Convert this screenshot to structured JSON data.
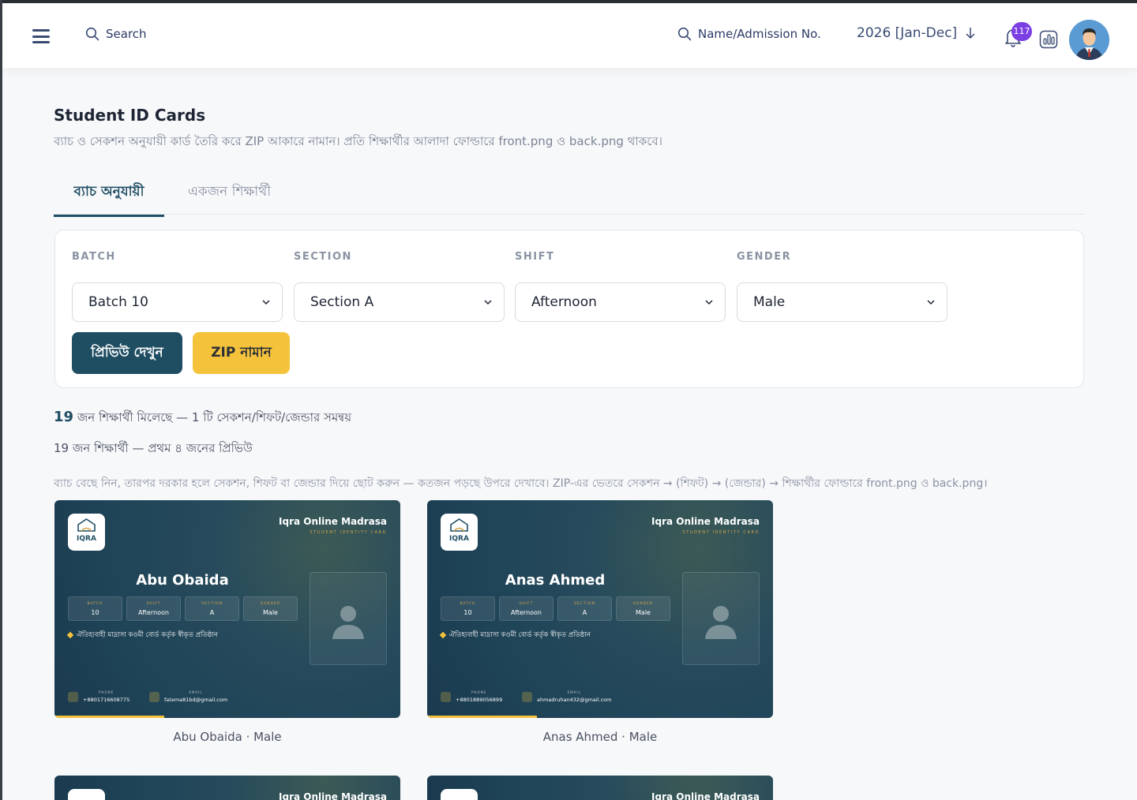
{
  "header": {
    "search_left": "Search",
    "search_right": "Name/Admission No.",
    "session": "2026 [Jan-Dec]",
    "notifications": "117"
  },
  "page": {
    "title": "Student ID Cards",
    "subtitle": "ব্যাচ ও সেকশন অনুযায়ী কার্ড তৈরি করে ZIP আকারে নামান। প্রতি শিক্ষার্থীর আলাদা ফোল্ডারে front.png ও back.png থাকবে।"
  },
  "tabs": [
    {
      "label": "ব্যাচ অনুযায়ী",
      "active": true
    },
    {
      "label": "একজন শিক্ষার্থী",
      "active": false
    }
  ],
  "filters": {
    "batch_label": "BATCH",
    "batch_value": "Batch 10",
    "section_label": "SECTION",
    "section_value": "Section A",
    "shift_label": "SHIFT",
    "shift_value": "Afternoon",
    "gender_label": "GENDER",
    "gender_value": "Male",
    "preview_button": "প্রিভিউ দেখুন",
    "zip_button": "ZIP নামান"
  },
  "summary": {
    "count": "19",
    "count_text": "জন শিক্ষার্থী মিলেছে — 1 টি সেকশন/শিফট/জেন্ডার সমন্বয়",
    "preview_text": "19 জন শিক্ষার্থী — প্রথম ৪ জনের প্রিভিউ",
    "help_text": "ব্যাচ বেছে নিন, তারপর দরকার হলে সেকশন, শিফট বা জেন্ডার দিয়ে ছোট করুন — কতজন পড়ছে উপরে দেখাবে। ZIP-এর ভেতরে সেকশন → (শিফট) → (জেন্ডার) → শিক্ষার্থীর ফোল্ডারে front.png ও back.png।"
  },
  "cards": [
    {
      "institution": "Iqra Online Madrasa",
      "card_type": "STUDENT IDENTITY CARD",
      "name": "Abu Obaida",
      "batch_label": "BATCH",
      "batch": "10",
      "shift_label": "SHIFT",
      "shift": "Afternoon",
      "section_label": "SECTION",
      "section": "A",
      "gender_label": "GENDER",
      "gender": "Male",
      "tagline": "ঐতিহ্যবাহী মাদ্রাসা কওমী বোর্ড কর্তৃক স্বীকৃত প্রতিষ্ঠান",
      "phone_label": "PHONE",
      "phone": "+8801716608775",
      "email_label": "EMAIL",
      "email": "fatema81bd@gmail.com",
      "caption": "Abu Obaida · Male"
    },
    {
      "institution": "Iqra Online Madrasa",
      "card_type": "STUDENT IDENTITY CARD",
      "name": "Anas Ahmed",
      "batch_label": "BATCH",
      "batch": "10",
      "shift_label": "SHIFT",
      "shift": "Afternoon",
      "section_label": "SECTION",
      "section": "A",
      "gender_label": "GENDER",
      "gender": "Male",
      "tagline": "ঐতিহ্যবাহী মাদ্রাসা কওমী বোর্ড কর্তৃক স্বীকৃত প্রতিষ্ঠান",
      "phone_label": "PHONE",
      "phone": "+8801889056899",
      "email_label": "EMAIL",
      "email": "ahmadruhan432@gmail.com",
      "caption": "Anas Ahmed · Male"
    },
    {
      "institution": "Iqra Online Madrasa"
    },
    {
      "institution": "Iqra Online Madrasa"
    }
  ],
  "colors": {
    "primary": "#1f4e63",
    "accent": "#f5c33b",
    "badge": "#7b3fe4"
  }
}
